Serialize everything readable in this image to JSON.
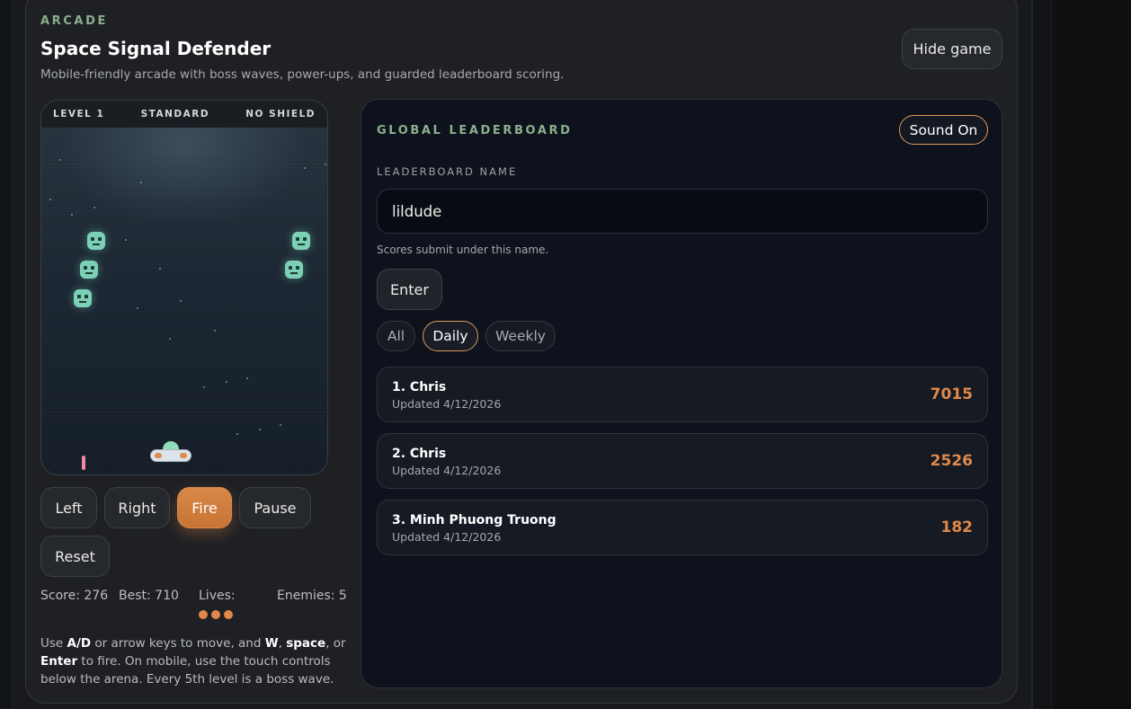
{
  "header": {
    "eyebrow": "ARCADE",
    "title": "Space Signal Defender",
    "subtitle": "Mobile-friendly arcade with boss waves, power-ups, and guarded leaderboard scoring.",
    "hide_label": "Hide game"
  },
  "game": {
    "hud": {
      "level": "LEVEL 1",
      "mode": "STANDARD",
      "shield": "NO SHIELD"
    },
    "controls": {
      "left": "Left",
      "right": "Right",
      "fire": "Fire",
      "pause": "Pause",
      "reset": "Reset"
    },
    "stats": {
      "score": "Score: 276",
      "best": "Best: 710",
      "lives_label": "Lives:",
      "lives": 3,
      "enemies": "Enemies: 5"
    },
    "help": {
      "p1": "Use ",
      "k1": "A/D",
      "p2": " or arrow keys to move, and ",
      "k2": "W",
      "p3": ", ",
      "k3": "space",
      "p4": ", or ",
      "k4": "Enter",
      "p5": " to fire. On mobile, use the touch controls below the arena. Every 5th level is a boss wave."
    },
    "colors": {
      "accent": "#e0894a",
      "enemy": "#7dd0b5"
    }
  },
  "leaderboard": {
    "title": "GLOBAL LEADERBOARD",
    "sound_label": "Sound On",
    "name_label": "LEADERBOARD NAME",
    "name_value": "lildude",
    "hint": "Scores submit under this name.",
    "enter_label": "Enter",
    "filters": [
      {
        "label": "All",
        "active": false
      },
      {
        "label": "Daily",
        "active": true
      },
      {
        "label": "Weekly",
        "active": false
      }
    ],
    "entries": [
      {
        "name": "1. Chris",
        "updated": "Updated 4/12/2026",
        "score": "7015"
      },
      {
        "name": "2. Chris",
        "updated": "Updated 4/12/2026",
        "score": "2526"
      },
      {
        "name": "3. Minh Phuong Truong",
        "updated": "Updated 4/12/2026",
        "score": "182"
      }
    ]
  }
}
